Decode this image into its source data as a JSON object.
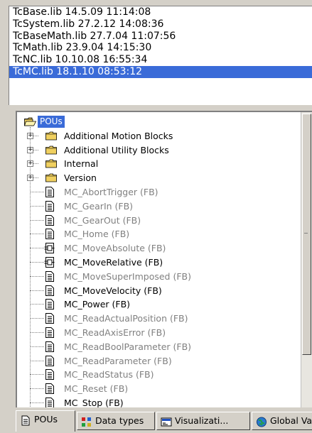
{
  "libraries": [
    {
      "label": "TcBase.lib 14.5.09 11:14:08",
      "selected": false
    },
    {
      "label": "TcSystem.lib 27.2.12 14:08:36",
      "selected": false
    },
    {
      "label": "TcBaseMath.lib 27.7.04 11:07:56",
      "selected": false
    },
    {
      "label": "TcMath.lib 23.9.04 14:15:30",
      "selected": false
    },
    {
      "label": "TcNC.lib 10.10.08 16:55:34",
      "selected": false
    },
    {
      "label": "TcMC.lib 18.1.10 08:53:12",
      "selected": true
    }
  ],
  "tree": {
    "root": {
      "label": "POUs",
      "icon": "folder-open-icon"
    },
    "folders": [
      {
        "label": "Additional Motion Blocks",
        "icon": "folder-icon"
      },
      {
        "label": "Additional Utility Blocks",
        "icon": "folder-icon"
      },
      {
        "label": "Internal",
        "icon": "folder-icon"
      },
      {
        "label": "Version",
        "icon": "folder-icon"
      }
    ],
    "items": [
      {
        "label": "MC_AbortTrigger (FB)",
        "active": false,
        "icon": "fb-document-icon"
      },
      {
        "label": "MC_GearIn (FB)",
        "active": false,
        "icon": "fb-document-icon"
      },
      {
        "label": "MC_GearOut (FB)",
        "active": false,
        "icon": "fb-document-icon"
      },
      {
        "label": "MC_Home (FB)",
        "active": false,
        "icon": "fb-document-icon"
      },
      {
        "label": "MC_MoveAbsolute (FB)",
        "active": false,
        "icon": "fb-diagram-icon"
      },
      {
        "label": "MC_MoveRelative (FB)",
        "active": true,
        "icon": "fb-diagram-icon"
      },
      {
        "label": "MC_MoveSuperImposed (FB)",
        "active": false,
        "icon": "fb-document-icon"
      },
      {
        "label": "MC_MoveVelocity (FB)",
        "active": true,
        "icon": "fb-document-icon"
      },
      {
        "label": "MC_Power (FB)",
        "active": true,
        "icon": "fb-document-icon"
      },
      {
        "label": "MC_ReadActualPosition (FB)",
        "active": false,
        "icon": "fb-document-icon"
      },
      {
        "label": "MC_ReadAxisError (FB)",
        "active": false,
        "icon": "fb-document-icon"
      },
      {
        "label": "MC_ReadBoolParameter (FB)",
        "active": false,
        "icon": "fb-document-icon"
      },
      {
        "label": "MC_ReadParameter (FB)",
        "active": false,
        "icon": "fb-document-icon"
      },
      {
        "label": "MC_ReadStatus (FB)",
        "active": false,
        "icon": "fb-document-icon"
      },
      {
        "label": "MC_Reset (FB)",
        "active": false,
        "icon": "fb-document-icon"
      },
      {
        "label": "MC_Stop (FB)",
        "active": true,
        "icon": "fb-document-icon"
      }
    ]
  },
  "tabs": [
    {
      "label": "POUs",
      "icon": "pous-tab-icon",
      "active": true
    },
    {
      "label": "Data types",
      "icon": "data-types-tab-icon",
      "active": false
    },
    {
      "label": "Visualizati...",
      "icon": "visualization-tab-icon",
      "active": false
    },
    {
      "label": "Global Va...",
      "icon": "global-variables-tab-icon",
      "active": false
    }
  ],
  "colors": {
    "selection": "#3a6bd8",
    "inactive_text": "#808080",
    "folder_yellow": "#f0d060",
    "panel_background": "#d4d0c8"
  }
}
